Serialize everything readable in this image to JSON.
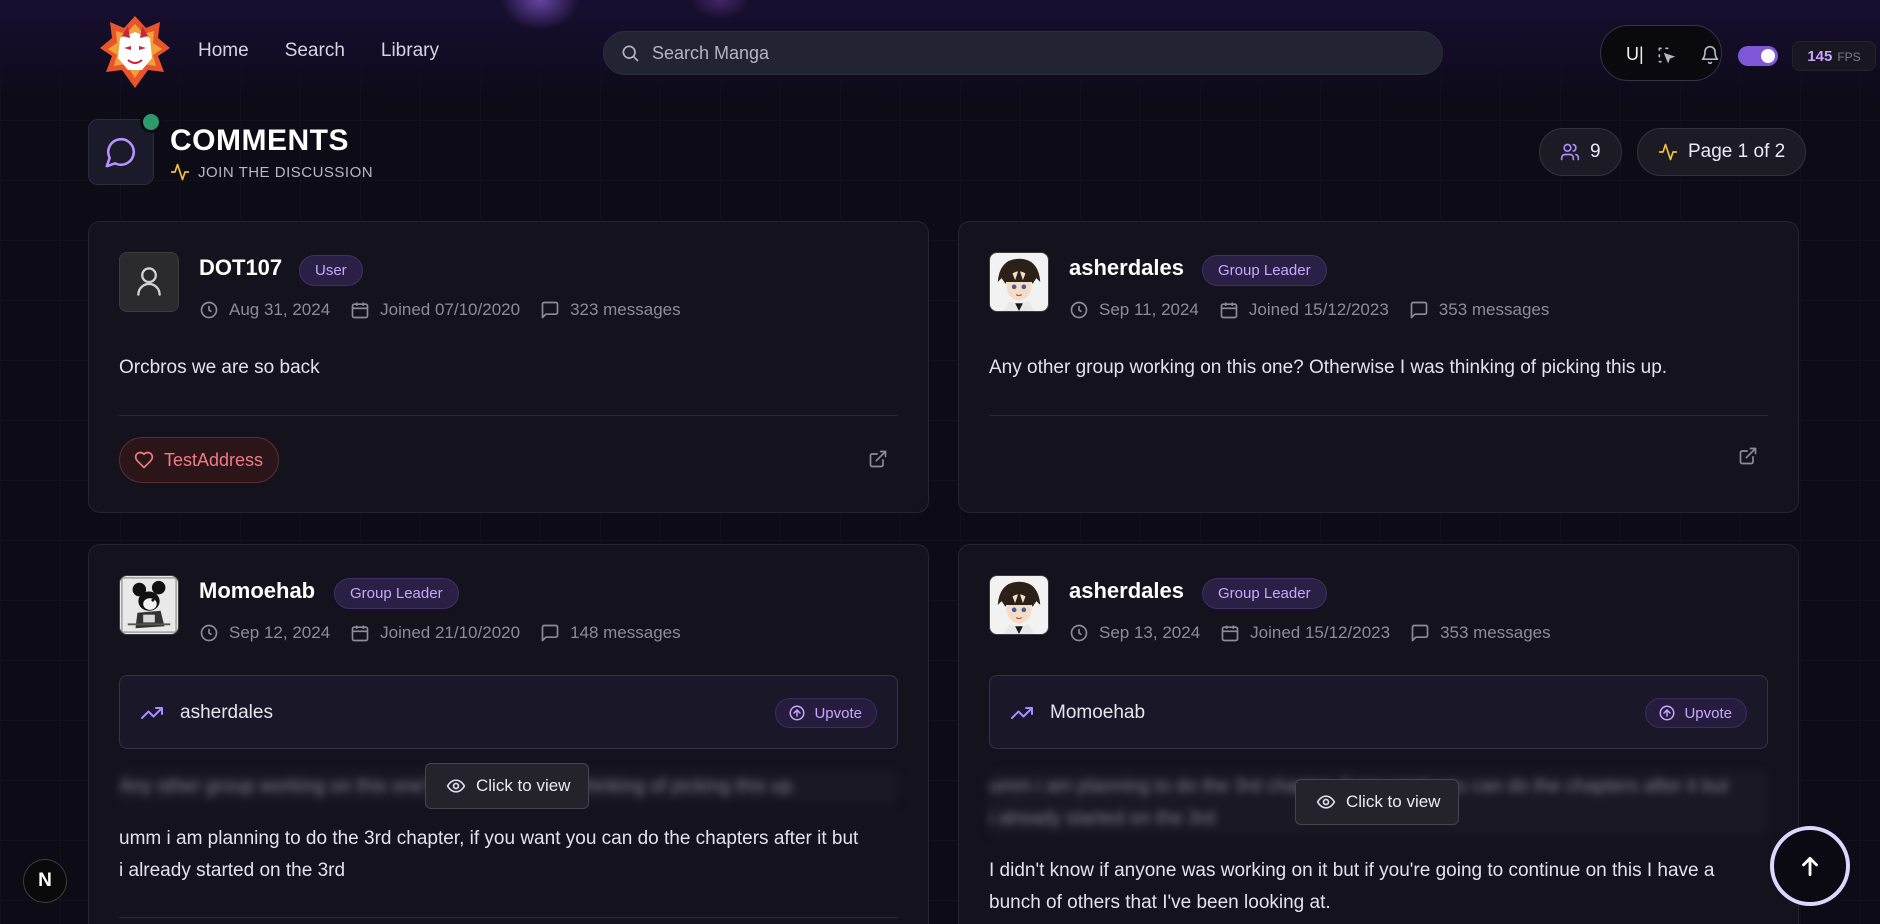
{
  "nav": {
    "items": [
      {
        "label": "Home"
      },
      {
        "label": "Search"
      },
      {
        "label": "Library"
      }
    ],
    "search_placeholder": "Search Manga"
  },
  "toolbar": {
    "tool_text": "U|",
    "fps_value": "145",
    "fps_label": "FPS",
    "theme_toggle_on": true
  },
  "section": {
    "title": "COMMENTS",
    "subtitle": "JOIN THE DISCUSSION",
    "participants": "9",
    "page": "Page 1 of 2"
  },
  "comments": [
    {
      "username": "DOT107",
      "role": "User",
      "date": "Aug 31, 2024",
      "joined": "Joined 07/10/2020",
      "messages": "323 messages",
      "text": "Orcbros we are so back",
      "support_label": "TestAddress"
    },
    {
      "username": "asherdales",
      "role": "Group Leader",
      "date": "Sep 11, 2024",
      "joined": "Joined 15/12/2023",
      "messages": "353 messages",
      "text": "Any other group working on this one? Otherwise I was thinking of picking this up."
    },
    {
      "username": "Momoehab",
      "role": "Group Leader",
      "date": "Sep 12, 2024",
      "joined": "Joined 21/10/2020",
      "messages": "148 messages",
      "reply_to": "asherdales",
      "upvote_label": "Upvote",
      "quoted_text": "Any other group working on this one? Otherwise I was thinking of picking this up.",
      "reveal_label": "Click to view",
      "text_line1": "umm i am planning to do the 3rd chapter, if you want you can do the chapters after it but",
      "text_line2": "i already started on the 3rd"
    },
    {
      "username": "asherdales",
      "role": "Group Leader",
      "date": "Sep 13, 2024",
      "joined": "Joined 15/12/2023",
      "messages": "353 messages",
      "reply_to": "Momoehab",
      "upvote_label": "Upvote",
      "quoted_text_line1": "umm i am planning to do the 3rd chapter, if you want you can do the chapters after it but",
      "quoted_text_line2": "i already started on the 3rd",
      "reveal_label": "Click to view",
      "text_line1": "I didn't know if anyone was working on it but if you're going to continue on this I have a",
      "text_line2": "bunch of others that I've been looking at."
    }
  ],
  "misc": {
    "next_badge": "N"
  },
  "colors": {
    "accent": "#c7a7ff",
    "toggle": "#7e58d8",
    "online": "#2c9a6b",
    "support": "#f07b86"
  }
}
